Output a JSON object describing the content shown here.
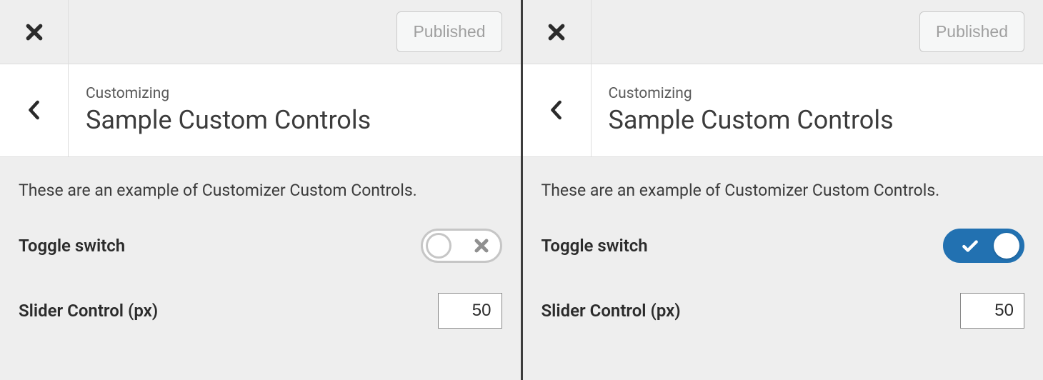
{
  "panels": [
    {
      "header": {
        "published_label": "Published"
      },
      "section": {
        "crumb": "Customizing",
        "title": "Sample Custom Controls"
      },
      "description": "These are an example of Customizer Custom Controls.",
      "toggle": {
        "label": "Toggle switch",
        "state": "off"
      },
      "slider": {
        "label": "Slider Control (px)",
        "value": "50"
      }
    },
    {
      "header": {
        "published_label": "Published"
      },
      "section": {
        "crumb": "Customizing",
        "title": "Sample Custom Controls"
      },
      "description": "These are an example of Customizer Custom Controls.",
      "toggle": {
        "label": "Toggle switch",
        "state": "on"
      },
      "slider": {
        "label": "Slider Control (px)",
        "value": "50"
      }
    }
  ]
}
